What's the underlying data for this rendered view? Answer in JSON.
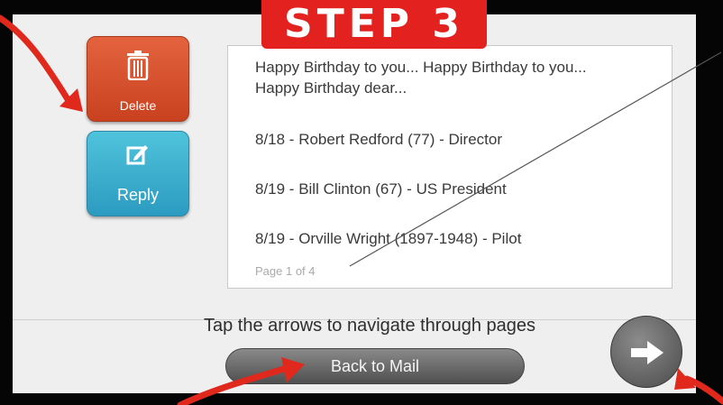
{
  "banner": {
    "label": "STEP 3"
  },
  "actions": {
    "delete_label": "Delete",
    "reply_label": "Reply"
  },
  "message": {
    "greeting": "Happy Birthday to you... Happy Birthday to you... Happy Birthday dear...",
    "items": [
      "8/18 - Robert Redford (77) - Director",
      "8/19 - Bill Clinton (67) - US President",
      "8/19 - Orville Wright (1897-1948) - Pilot"
    ],
    "page_indicator": "Page 1 of 4"
  },
  "footer": {
    "instruction": "Tap the arrows to navigate through pages",
    "back_label": "Back to Mail",
    "next_icon": "right-arrow-icon"
  },
  "colors": {
    "delete": "#d9522e",
    "reply": "#3bb0d2",
    "banner": "#e3221f",
    "annotation": "#e0281d"
  }
}
